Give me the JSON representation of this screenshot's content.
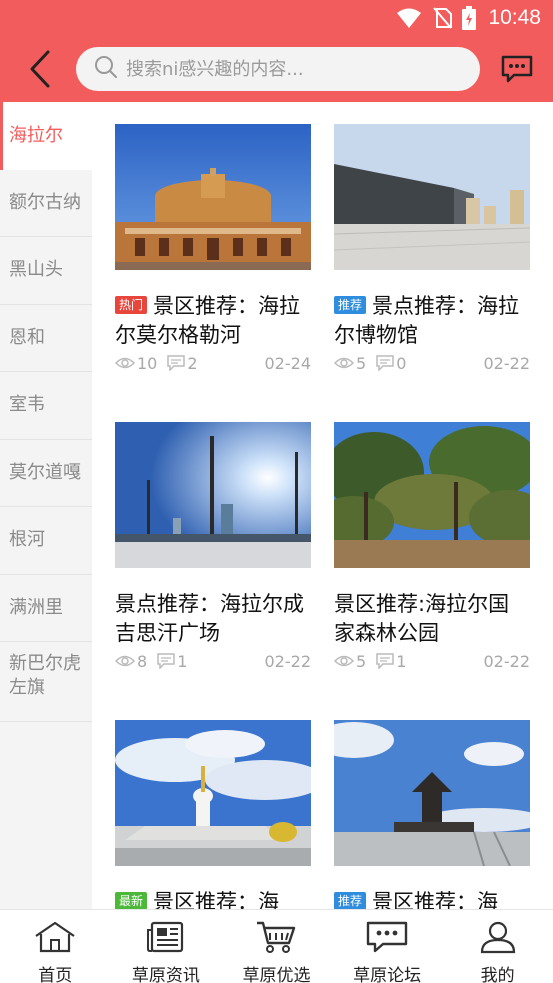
{
  "status_bar": {
    "time": "10:48"
  },
  "header": {
    "search_placeholder": "搜索ni感兴趣的内容..."
  },
  "sidebar": {
    "items": [
      {
        "label": "海拉尔",
        "active": true
      },
      {
        "label": "额尔古纳"
      },
      {
        "label": "黑山头"
      },
      {
        "label": "恩和"
      },
      {
        "label": "室韦"
      },
      {
        "label": "莫尔道嘎"
      },
      {
        "label": "根河"
      },
      {
        "label": "满洲里"
      },
      {
        "label": "新巴尔虎左旗"
      }
    ]
  },
  "cards": [
    {
      "badge": "热门",
      "title": "景区推荐：海拉尔莫尔格勒河",
      "views": "10",
      "comments": "2",
      "date": "02-24"
    },
    {
      "badge": "推荐",
      "title": "景点推荐：海拉尔博物馆",
      "views": "5",
      "comments": "0",
      "date": "02-22"
    },
    {
      "badge": "",
      "title": "景点推荐：海拉尔成吉思汗广场",
      "views": "8",
      "comments": "1",
      "date": "02-22"
    },
    {
      "badge": "",
      "title": "景区推荐:海拉尔国家森林公园",
      "views": "5",
      "comments": "1",
      "date": "02-22"
    },
    {
      "badge": "最新",
      "title": "景区推荐：海",
      "views": "",
      "comments": "",
      "date": ""
    },
    {
      "badge": "推荐",
      "title": "景区推荐：海",
      "views": "",
      "comments": "",
      "date": ""
    }
  ],
  "tabbar": {
    "tabs": [
      {
        "label": "首页",
        "icon": "home-icon"
      },
      {
        "label": "草原资讯",
        "icon": "news-icon"
      },
      {
        "label": "草原优选",
        "icon": "cart-icon"
      },
      {
        "label": "草原论坛",
        "icon": "chat-icon"
      },
      {
        "label": "我的",
        "icon": "user-icon"
      }
    ]
  },
  "colors": {
    "brand": "#f25c5c",
    "hot": "#e8453c",
    "recommend": "#2f8ddf",
    "new": "#4cb83a"
  }
}
